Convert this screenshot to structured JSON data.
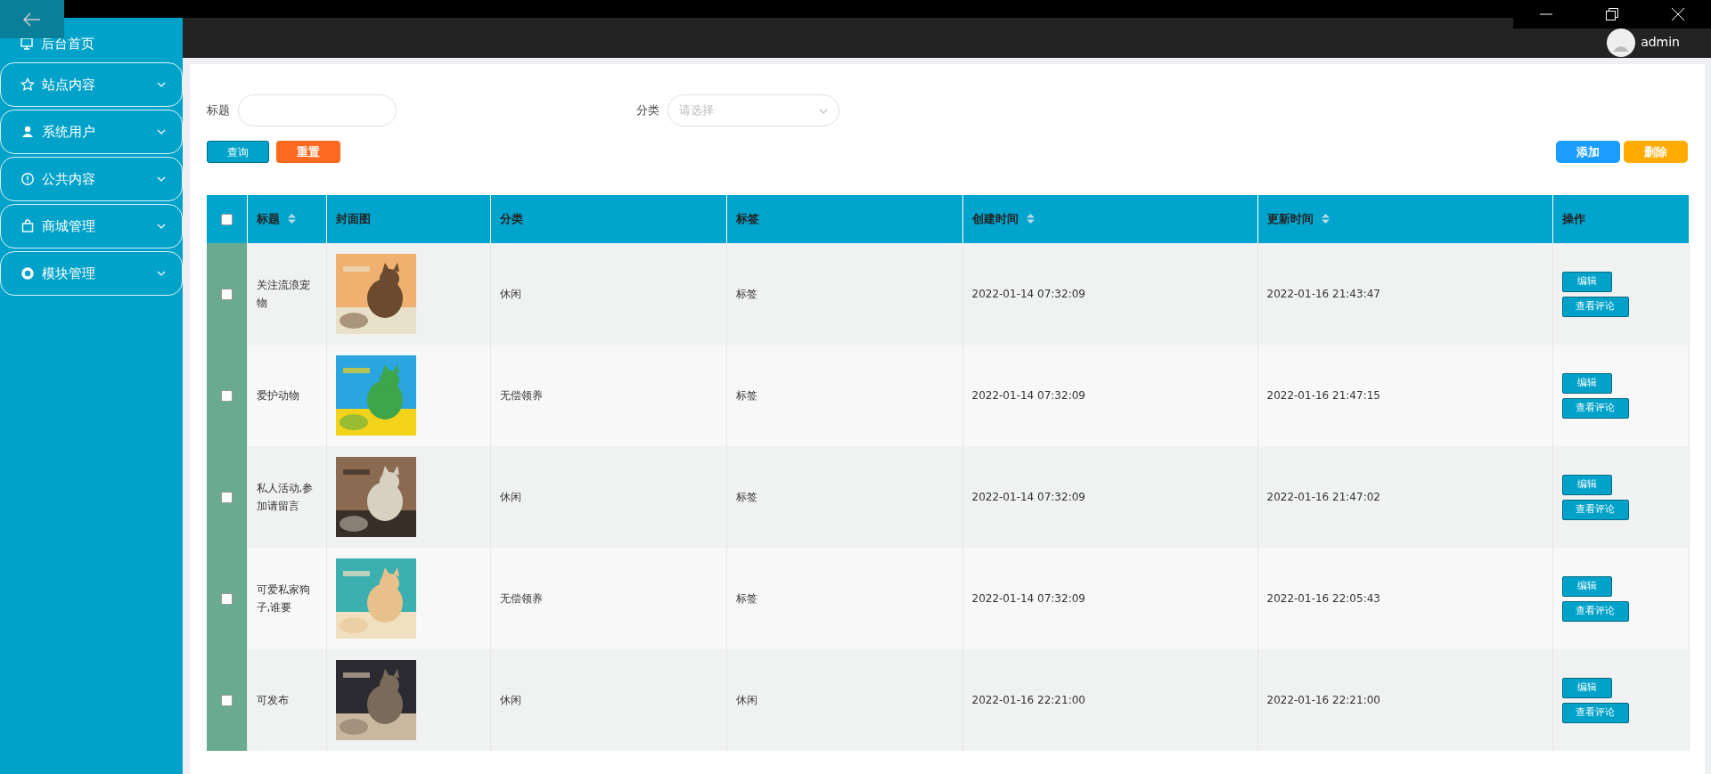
{
  "sidebar": {
    "items": [
      {
        "label": "后台首页",
        "kind": "link"
      },
      {
        "label": "站点内容",
        "kind": "menu"
      },
      {
        "label": "系统用户",
        "kind": "menu"
      },
      {
        "label": "公共内容",
        "kind": "menu"
      },
      {
        "label": "商城管理",
        "kind": "menu"
      },
      {
        "label": "模块管理",
        "kind": "menu"
      }
    ]
  },
  "header": {
    "user": "admin"
  },
  "filters": [
    {
      "label": "标题",
      "kind": "text"
    },
    {
      "label": "分类",
      "kind": "select",
      "placeholder": "请选择"
    }
  ],
  "search_buttons": [
    {
      "label": "查询",
      "kind": "query"
    },
    {
      "label": "重置",
      "kind": "reset"
    }
  ],
  "toolbar_buttons": [
    {
      "label": "添加",
      "kind": "add"
    },
    {
      "label": "删除",
      "kind": "delete"
    }
  ],
  "table": {
    "select_all_checked": false,
    "columns": [
      {
        "label": "标题",
        "sortable": true
      },
      {
        "label": "封面图",
        "sortable": false
      },
      {
        "label": "分类",
        "sortable": false
      },
      {
        "label": "标签",
        "sortable": false
      },
      {
        "label": "创建时间",
        "sortable": true
      },
      {
        "label": "更新时间",
        "sortable": true
      },
      {
        "label": "操作",
        "sortable": false
      }
    ],
    "rows": [
      {
        "checked": false,
        "title": "关注流浪宠物",
        "category": "休闲",
        "tag": "标签",
        "created": "2022-01-14 07:32:09",
        "updated": "2022-01-16 21:43:47",
        "actions": [
          "编辑",
          "查看评论"
        ]
      },
      {
        "checked": false,
        "title": "爱护动物",
        "category": "无偿领养",
        "tag": "标签",
        "created": "2022-01-14 07:32:09",
        "updated": "2022-01-16 21:47:15",
        "actions": [
          "编辑",
          "查看评论"
        ]
      },
      {
        "checked": false,
        "title": "私人活动,参加请留言",
        "category": "休闲",
        "tag": "标签",
        "created": "2022-01-14 07:32:09",
        "updated": "2022-01-16 21:47:02",
        "actions": [
          "编辑",
          "查看评论"
        ]
      },
      {
        "checked": false,
        "title": "可爱私家狗子,谁要",
        "category": "无偿领养",
        "tag": "标签",
        "created": "2022-01-14 07:32:09",
        "updated": "2022-01-16 22:05:43",
        "actions": [
          "编辑",
          "查看评论"
        ]
      },
      {
        "checked": false,
        "title": "可发布",
        "category": "休闲",
        "tag": "休闲",
        "created": "2022-01-16 22:21:00",
        "updated": "2022-01-16 22:21:00",
        "actions": [
          "编辑",
          "查看评论"
        ]
      }
    ]
  }
}
